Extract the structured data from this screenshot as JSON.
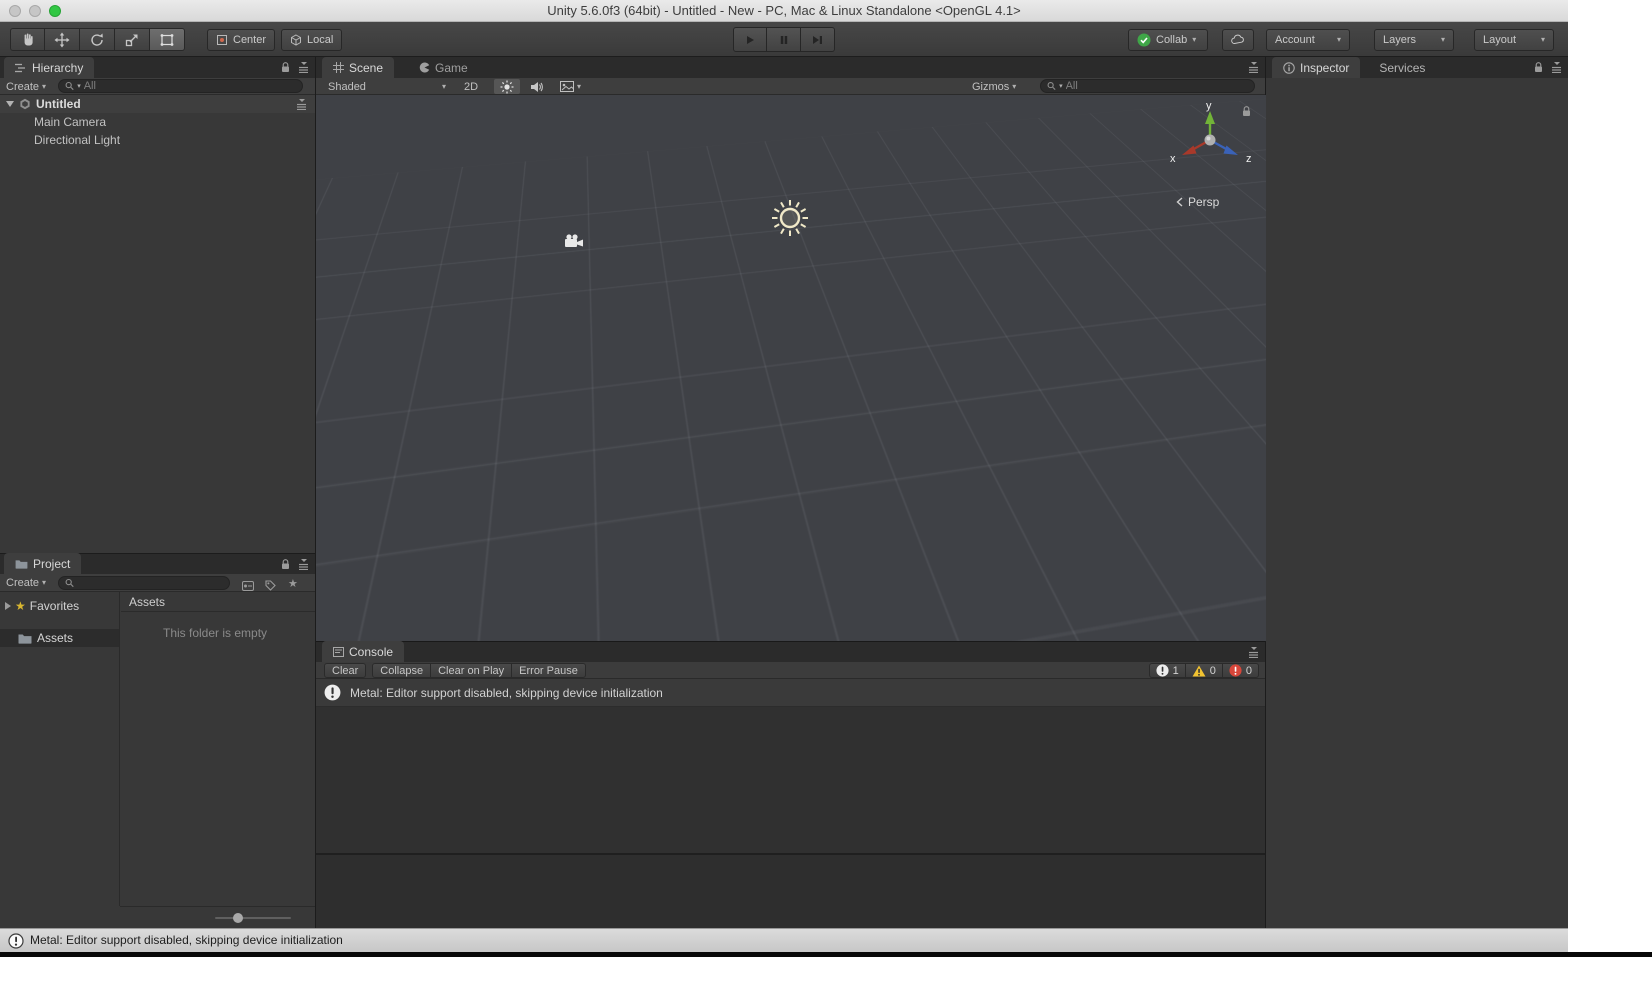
{
  "window": {
    "title": "Unity 5.6.0f3 (64bit) - Untitled - New - PC, Mac & Linux Standalone <OpenGL 4.1>"
  },
  "toolbar": {
    "pivot_label": "Center",
    "space_label": "Local",
    "collab_label": "Collab",
    "account_label": "Account",
    "layers_label": "Layers",
    "layout_label": "Layout"
  },
  "hierarchy": {
    "tab_label": "Hierarchy",
    "create_label": "Create",
    "search_placeholder": "All",
    "scene_name": "Untitled",
    "items": [
      {
        "label": "Main Camera"
      },
      {
        "label": "Directional Light"
      }
    ]
  },
  "project": {
    "tab_label": "Project",
    "create_label": "Create",
    "search_placeholder": "",
    "favorites_label": "Favorites",
    "assets_folder_label": "Assets",
    "assets_header": "Assets",
    "empty_message": "This folder is empty"
  },
  "scene": {
    "tab_label": "Scene",
    "game_tab_label": "Game",
    "draw_mode_label": "Shaded",
    "toggle_2d_label": "2D",
    "gizmos_label": "Gizmos",
    "search_placeholder": "All",
    "projection_label": "Persp",
    "axis": {
      "x": "x",
      "y": "y",
      "z": "z"
    }
  },
  "console": {
    "tab_label": "Console",
    "clear_label": "Clear",
    "collapse_label": "Collapse",
    "clear_on_play_label": "Clear on Play",
    "error_pause_label": "Error Pause",
    "info_count": "1",
    "warning_count": "0",
    "error_count": "0",
    "message": "Metal: Editor support disabled, skipping device initialization"
  },
  "inspector": {
    "tab_label": "Inspector",
    "services_tab_label": "Services"
  },
  "status_bar": {
    "message": "Metal: Editor support disabled, skipping device initialization"
  },
  "icons": {
    "chevron_down": "▾",
    "star": "★"
  },
  "colors": {
    "axis_x": "#a8392a",
    "axis_y": "#72b338",
    "axis_z": "#3a62b8",
    "warning_yellow": "#f2c331",
    "error_red": "#d8463a",
    "collab_green": "#3fa648",
    "sun_gizmo": "#f1e9c8"
  }
}
